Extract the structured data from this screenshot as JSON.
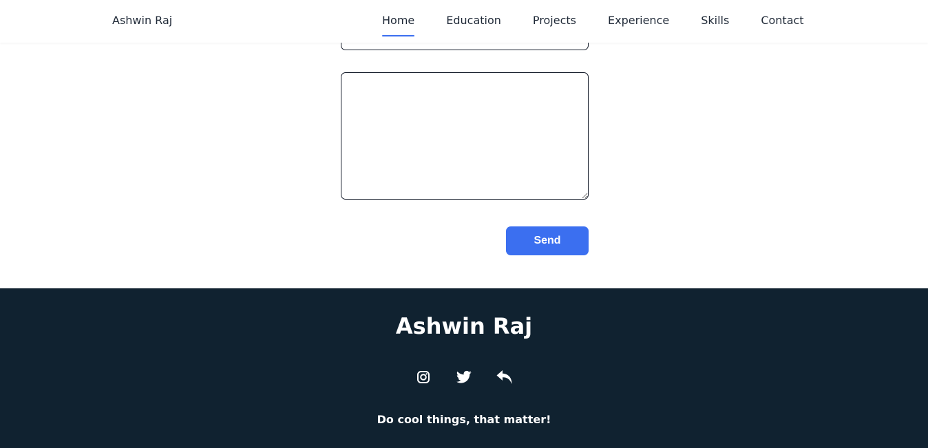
{
  "header": {
    "brand": "Ashwin Raj",
    "nav": [
      {
        "label": "Home",
        "active": true
      },
      {
        "label": "Education",
        "active": false
      },
      {
        "label": "Projects",
        "active": false
      },
      {
        "label": "Experience",
        "active": false
      },
      {
        "label": "Skills",
        "active": false
      },
      {
        "label": "Contact",
        "active": false
      }
    ]
  },
  "form": {
    "previous_field_value": "",
    "message_value": "",
    "send_label": "Send"
  },
  "footer": {
    "name": "Ashwin Raj",
    "social_icons": [
      "instagram-icon",
      "twitter-icon",
      "reply-icon"
    ],
    "tagline": "Do cool things, that matter!"
  },
  "colors": {
    "accent": "#3b6ff0",
    "footer_bg": "#102230",
    "text_dark": "#1f2937",
    "white": "#ffffff"
  }
}
